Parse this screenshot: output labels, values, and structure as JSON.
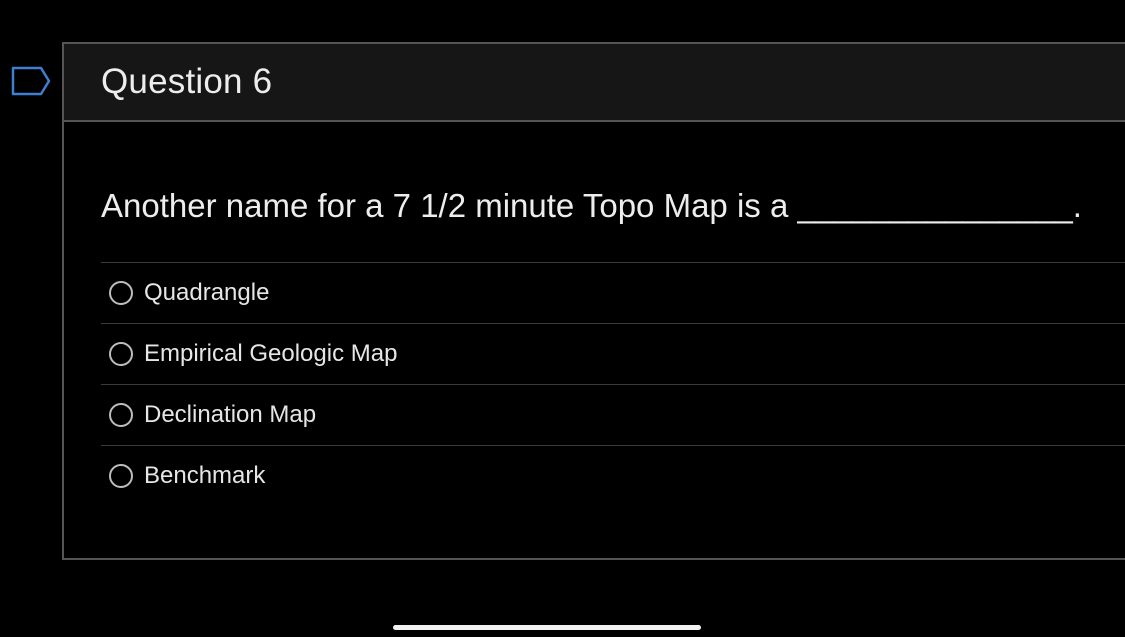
{
  "question": {
    "title": "Question 6",
    "text": "Another name for a 7 1/2 minute Topo Map is a _______________.",
    "flag_icon": "flag-outline-icon"
  },
  "answers": [
    {
      "label": "Quadrangle",
      "selected": false
    },
    {
      "label": "Empirical Geologic Map",
      "selected": false
    },
    {
      "label": "Declination Map",
      "selected": false
    },
    {
      "label": "Benchmark",
      "selected": false
    }
  ],
  "colors": {
    "background": "#000000",
    "header_background": "#161616",
    "border": "#555555",
    "text": "#ededed"
  }
}
